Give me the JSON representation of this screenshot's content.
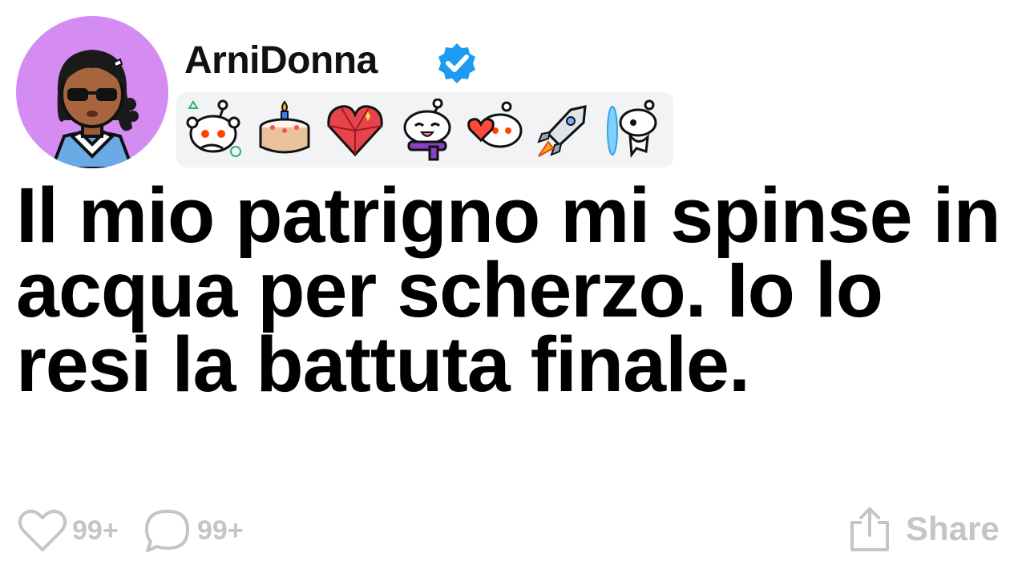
{
  "post": {
    "username": "ArniDonna",
    "title": "Il mio patrigno mi spinse in acqua per scherzo. Io lo resi la battuta finale.",
    "likes": "99+",
    "comments": "99+",
    "share_label": "Share"
  },
  "avatar": {
    "background": "#d48cf2"
  },
  "verified_badge": {
    "color": "#1d9bf0",
    "icon": "check-icon"
  },
  "badges": [
    {
      "name": "snoo-thinking-badge-icon"
    },
    {
      "name": "birthday-cake-badge-icon"
    },
    {
      "name": "crystal-heart-badge-icon"
    },
    {
      "name": "snoo-scarf-badge-icon"
    },
    {
      "name": "snoo-heart-badge-icon"
    },
    {
      "name": "rocket-badge-icon"
    },
    {
      "name": "portal-snoo-badge-icon"
    }
  ],
  "colors": {
    "text": "#000000",
    "muted": "#c5c5c5",
    "badge_strip": "#f2f3f5"
  }
}
